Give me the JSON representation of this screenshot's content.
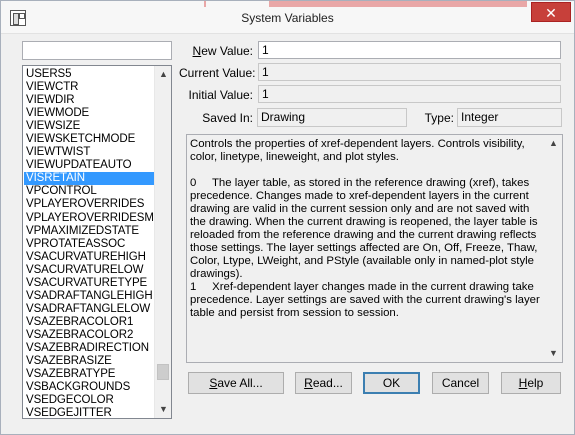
{
  "window": {
    "title": "System Variables",
    "close_glyph": "✕"
  },
  "list": {
    "items": [
      "USERS5",
      "VIEWCTR",
      "VIEWDIR",
      "VIEWMODE",
      "VIEWSIZE",
      "VIEWSKETCHMODE",
      "VIEWTWIST",
      "VIEWUPDATEAUTO",
      "VISRETAIN",
      "VPCONTROL",
      "VPLAYEROVERRIDES",
      "VPLAYEROVERRIDESMC",
      "VPMAXIMIZEDSTATE",
      "VPROTATEASSOC",
      "VSACURVATUREHIGH",
      "VSACURVATURELOW",
      "VSACURVATURETYPE",
      "VSADRAFTANGLEHIGH",
      "VSADRAFTANGLELOW",
      "VSAZEBRACOLOR1",
      "VSAZEBRACOLOR2",
      "VSAZEBRADIRECTION",
      "VSAZEBRASIZE",
      "VSAZEBRATYPE",
      "VSBACKGROUNDS",
      "VSEDGECOLOR",
      "VSEDGEJITTER"
    ],
    "selected": "VISRETAIN"
  },
  "fields": {
    "new_value_label_u": "N",
    "new_value_label_rest": "ew Value:",
    "new_value": "1",
    "current_value_label": "Current Value:",
    "current_value": "1",
    "initial_value_label": "Initial Value:",
    "initial_value": "1",
    "saved_in_label": "Saved In:",
    "saved_in": "Drawing",
    "type_label": "Type:",
    "type": "Integer"
  },
  "description": {
    "intro": "Controls the properties of xref-dependent layers. Controls visibility, color, linetype, lineweight, and plot styles.",
    "opt0": "0     The layer table, as stored in the reference drawing (xref), takes precedence. Changes made to xref-dependent layers in the current drawing are valid in the current session only and are not saved with the drawing. When the current drawing is reopened, the layer table is reloaded from the reference drawing and the current drawing reflects those settings. The layer settings affected are On, Off, Freeze, Thaw, Color, Ltype, LWeight, and PStyle (available only in named-plot style drawings).",
    "opt1": "1     Xref-dependent layer changes made in the current drawing take precedence. Layer settings are saved with the current drawing's layer table and persist from session to session."
  },
  "buttons": {
    "save_all_u": "S",
    "save_all_rest": "ave All...",
    "read_u": "R",
    "read_rest": "ead...",
    "ok": "OK",
    "cancel": "Cancel",
    "help_u": "H",
    "help_rest": "elp"
  }
}
